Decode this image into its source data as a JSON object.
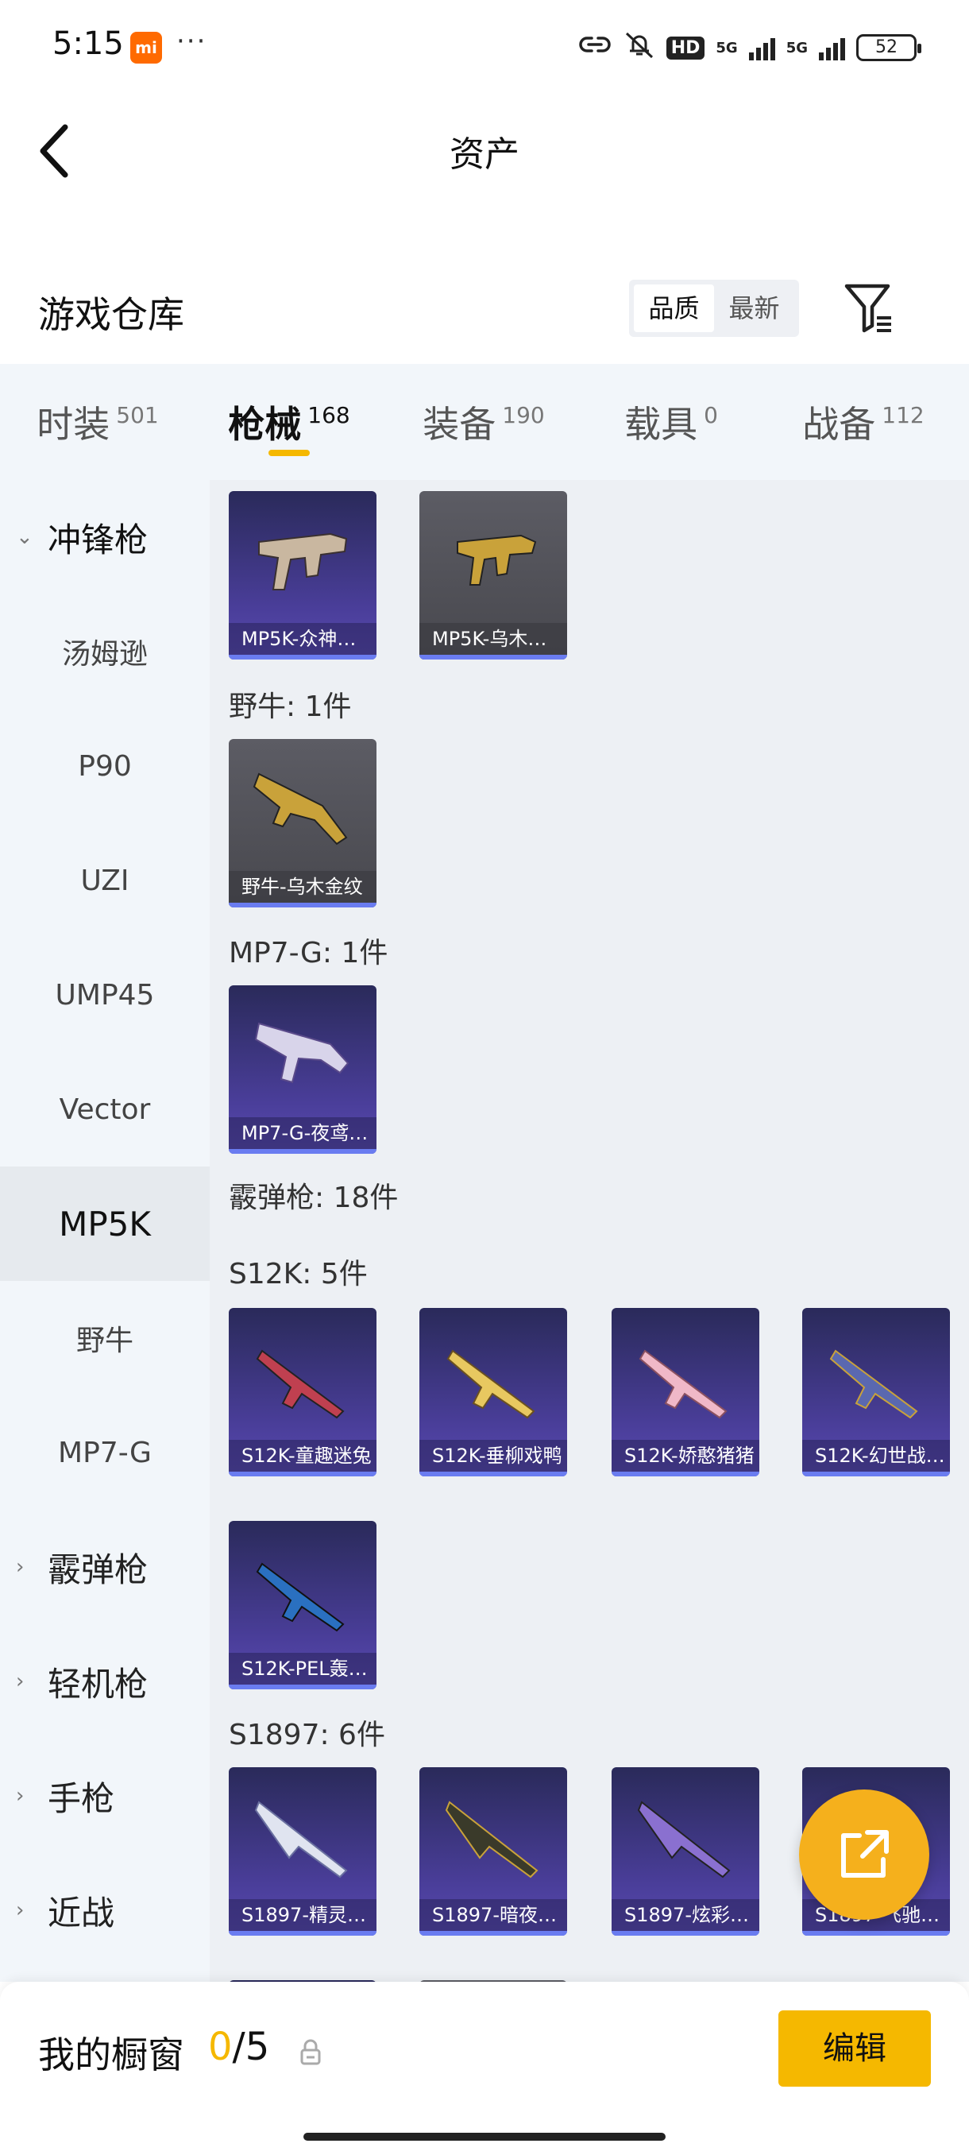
{
  "status_bar": {
    "time": "5:15",
    "mi_badge": "mi",
    "more": "···",
    "hd_label": "HD",
    "net1": "5G",
    "net2": "5G",
    "battery": "52"
  },
  "header": {
    "back_icon": "chevron-left-icon",
    "title": "资产"
  },
  "section": {
    "title": "游戏仓库",
    "sort_options": [
      "品质",
      "最新"
    ],
    "sort_selected": "品质",
    "filter_icon": "filter-icon"
  },
  "tabs": [
    {
      "label": "时装",
      "count": "501"
    },
    {
      "label": "枪械",
      "count": "168",
      "active": true
    },
    {
      "label": "装备",
      "count": "190"
    },
    {
      "label": "载具",
      "count": "0"
    },
    {
      "label": "战备",
      "count": "112"
    }
  ],
  "sidebar": [
    {
      "label": "冲锋枪",
      "type": "category",
      "expanded": true
    },
    {
      "label": "汤姆逊"
    },
    {
      "label": "P90"
    },
    {
      "label": "UZI"
    },
    {
      "label": "UMP45"
    },
    {
      "label": "Vector"
    },
    {
      "label": "MP5K",
      "selected": true
    },
    {
      "label": "野牛"
    },
    {
      "label": "MP7-G"
    },
    {
      "label": "霰弹枪",
      "type": "category"
    },
    {
      "label": "轻机枪",
      "type": "category"
    },
    {
      "label": "手枪",
      "type": "category"
    },
    {
      "label": "近战",
      "type": "category"
    }
  ],
  "content": {
    "groups": [
      {
        "label": "",
        "items": [
          "MP5K-众神…",
          "MP5K-乌木…"
        ]
      },
      {
        "label": "野牛: 1件",
        "items": [
          "野牛-乌木金纹"
        ]
      },
      {
        "label": "MP7-G: 1件",
        "items": [
          "MP7-G-夜鸢…"
        ]
      },
      {
        "label": "霰弹枪: 18件",
        "items": []
      },
      {
        "label": "S12K: 5件",
        "items": [
          "S12K-童趣迷兔",
          "S12K-垂柳戏鸭",
          "S12K-娇憨猪猪",
          "S12K-幻世战…",
          "S12K-PEL轰…"
        ]
      },
      {
        "label": "S1897: 6件",
        "items": [
          "S1897-精灵…",
          "S1897-暗夜…",
          "S1897-炫彩…",
          "S1897-飞驰…"
        ]
      }
    ]
  },
  "fab": {
    "icon": "share-export-icon"
  },
  "bottom_bar": {
    "label": "我的橱窗",
    "current": "0",
    "separator": "/",
    "total": "5",
    "lock_icon": "lock-icon",
    "edit_label": "编辑"
  }
}
